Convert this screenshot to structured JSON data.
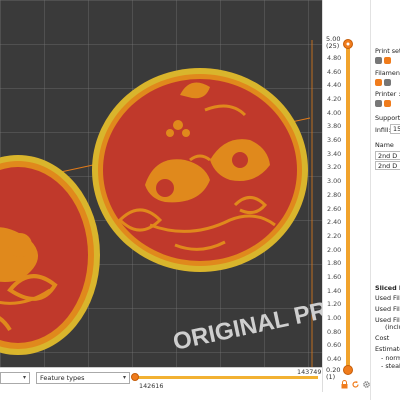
{
  "viewport": {
    "bed_text": "ORIGINAL PRUS"
  },
  "layer_slider": {
    "top_value": "5.00",
    "top_layer": "(25)",
    "bottom_value": "0.20",
    "bottom_layer": "(1)",
    "ticks": [
      "4.80",
      "4.60",
      "4.40",
      "4.20",
      "4.00",
      "3.80",
      "3.60",
      "3.40",
      "3.20",
      "3.00",
      "2.80",
      "2.60",
      "2.40",
      "2.20",
      "2.00",
      "1.80",
      "1.60",
      "1.40",
      "1.20",
      "1.00",
      "0.80",
      "0.60",
      "0.40"
    ]
  },
  "sidebar": {
    "print_settings": "Print settings :",
    "filament": "Filament :",
    "printer": "Printer :",
    "supports": "Supports:",
    "infill_label": "Infill:",
    "infill_value": "15%",
    "name_header": "Name",
    "objects": [
      "2nd D",
      "2nd D"
    ],
    "sliced_info": "Sliced Info",
    "used_filament_1": "Used Filam",
    "used_filament_2": "Used Filam",
    "used_filament_3": "Used Filam",
    "including": "(inclu",
    "cost": "Cost",
    "estimated": "Estimated",
    "normal": "- norm",
    "stealth": "- stealt"
  },
  "bottom_bar": {
    "view_dropdown": "",
    "feature_dropdown": "Feature types",
    "h_max": "143749",
    "h_min": "142616"
  },
  "colors": {
    "accent": "#f07c1c",
    "slider_track": "#f2b132",
    "coaster_red": "#c0392b",
    "coaster_orange": "#e0891c",
    "coaster_rim": "#d9b52c"
  },
  "icons": [
    "settings-icon",
    "lock-icon",
    "refresh-icon",
    "gear-icon",
    "chevron-down-icon"
  ]
}
